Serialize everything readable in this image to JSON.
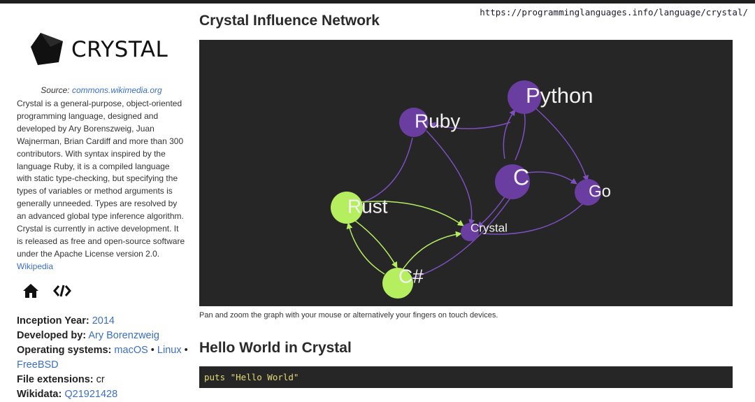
{
  "url": "https://programminglanguages.info/language/crystal/",
  "sidebar": {
    "logo_text": "CRYSTAL",
    "source_prefix": "Source:",
    "source_link": "commons.wikimedia.org",
    "description": "Crystal is a general-purpose, object-oriented programming language, designed and developed by Ary Borenszweig, Juan Wajnerman, Brian Cardiff and more than 300 contributors. With syntax inspired by the language Ruby, it is a compiled language with static type-checking, but specifying the types of variables or method arguments is generally unneeded. Types are resolved by an advanced global type inference algorithm. Crystal is currently in active development. It is released as free and open-source software under the Apache License version 2.0.",
    "wikipedia_link": "Wikipedia",
    "icons": [
      "home-icon",
      "code-icon"
    ],
    "facts": {
      "inception_label": "Inception Year:",
      "inception_value": "2014",
      "developed_label": "Developed by:",
      "developed_value": "Ary Borenzweig",
      "os_label": "Operating systems:",
      "os_values": [
        "macOS",
        "Linux",
        "FreeBSD"
      ],
      "ext_label": "File extensions:",
      "ext_value": "cr",
      "wikidata_label": "Wikidata:",
      "wikidata_value": "Q21921428"
    }
  },
  "main": {
    "network_title": "Crystal Influence Network",
    "graph_nodes": [
      {
        "label": "Python",
        "color": "#6a3ea1"
      },
      {
        "label": "Ruby",
        "color": "#6a3ea1"
      },
      {
        "label": "C",
        "color": "#6a3ea1"
      },
      {
        "label": "Go",
        "color": "#6a3ea1"
      },
      {
        "label": "Rust",
        "color": "#b5ee5f"
      },
      {
        "label": "Crystal",
        "color": "#6a3ea1"
      },
      {
        "label": "C#",
        "color": "#b5ee5f"
      }
    ],
    "graph_caption": "Pan and zoom the graph with your mouse or alternatively your fingers on touch devices.",
    "hello_title": "Hello World in Crystal",
    "hello_code": "puts \"Hello World\""
  }
}
